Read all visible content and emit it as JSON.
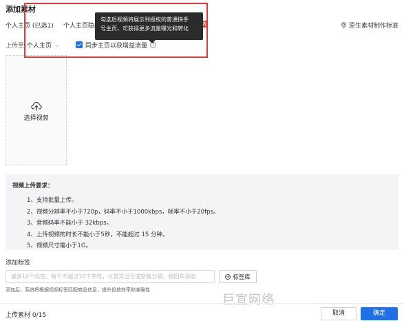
{
  "dialog": {
    "title": "添加素材"
  },
  "tabs": [
    {
      "label": "个人主页 (已选1)"
    },
    {
      "label": "个人主页隐藏"
    }
  ],
  "hot_badge": "热",
  "standard_link": {
    "label": "原生素材制作标准",
    "icon": "location-pin-icon"
  },
  "tooltip": {
    "line1": "勾选后视频将展示到授权的普通快手",
    "line2": "号主页，可获得更多流量曝光和转化"
  },
  "upload": {
    "label": "上传至",
    "select_value": "个人主页",
    "sync_checked": true,
    "sync_label": "同步主页以获增益流量",
    "area_label": "选择视频",
    "area_icon": "cloud-upload-icon"
  },
  "requirements": {
    "title": "视频上传要求：",
    "items": [
      "1、支持批量上传。",
      "2、视频分辨率不小于720p，码率不小于1000kbps，帧率不小于20fps。",
      "3、音频码率不能小于 32kbps。",
      "4、上传视频的时长不能小于5秒，不能超过 15 分钟。",
      "5、视频尺寸需小于1G。"
    ]
  },
  "tags": {
    "label": "添加标签",
    "placeholder": "最多10个标签。每个不超过10个字符，以英文逗号或空格分隔，按回车添加",
    "library_button": "标签库",
    "hint": "添加后，系统将根据视频标签匹配商品信息，提升投放效率和准确性"
  },
  "watermark": "巨宣网络",
  "footer": {
    "count": "上传素材 0/15",
    "cancel": "取消",
    "confirm": "确定"
  },
  "colors": {
    "primary": "#1f6fe5",
    "highlight_border": "#e53935"
  }
}
